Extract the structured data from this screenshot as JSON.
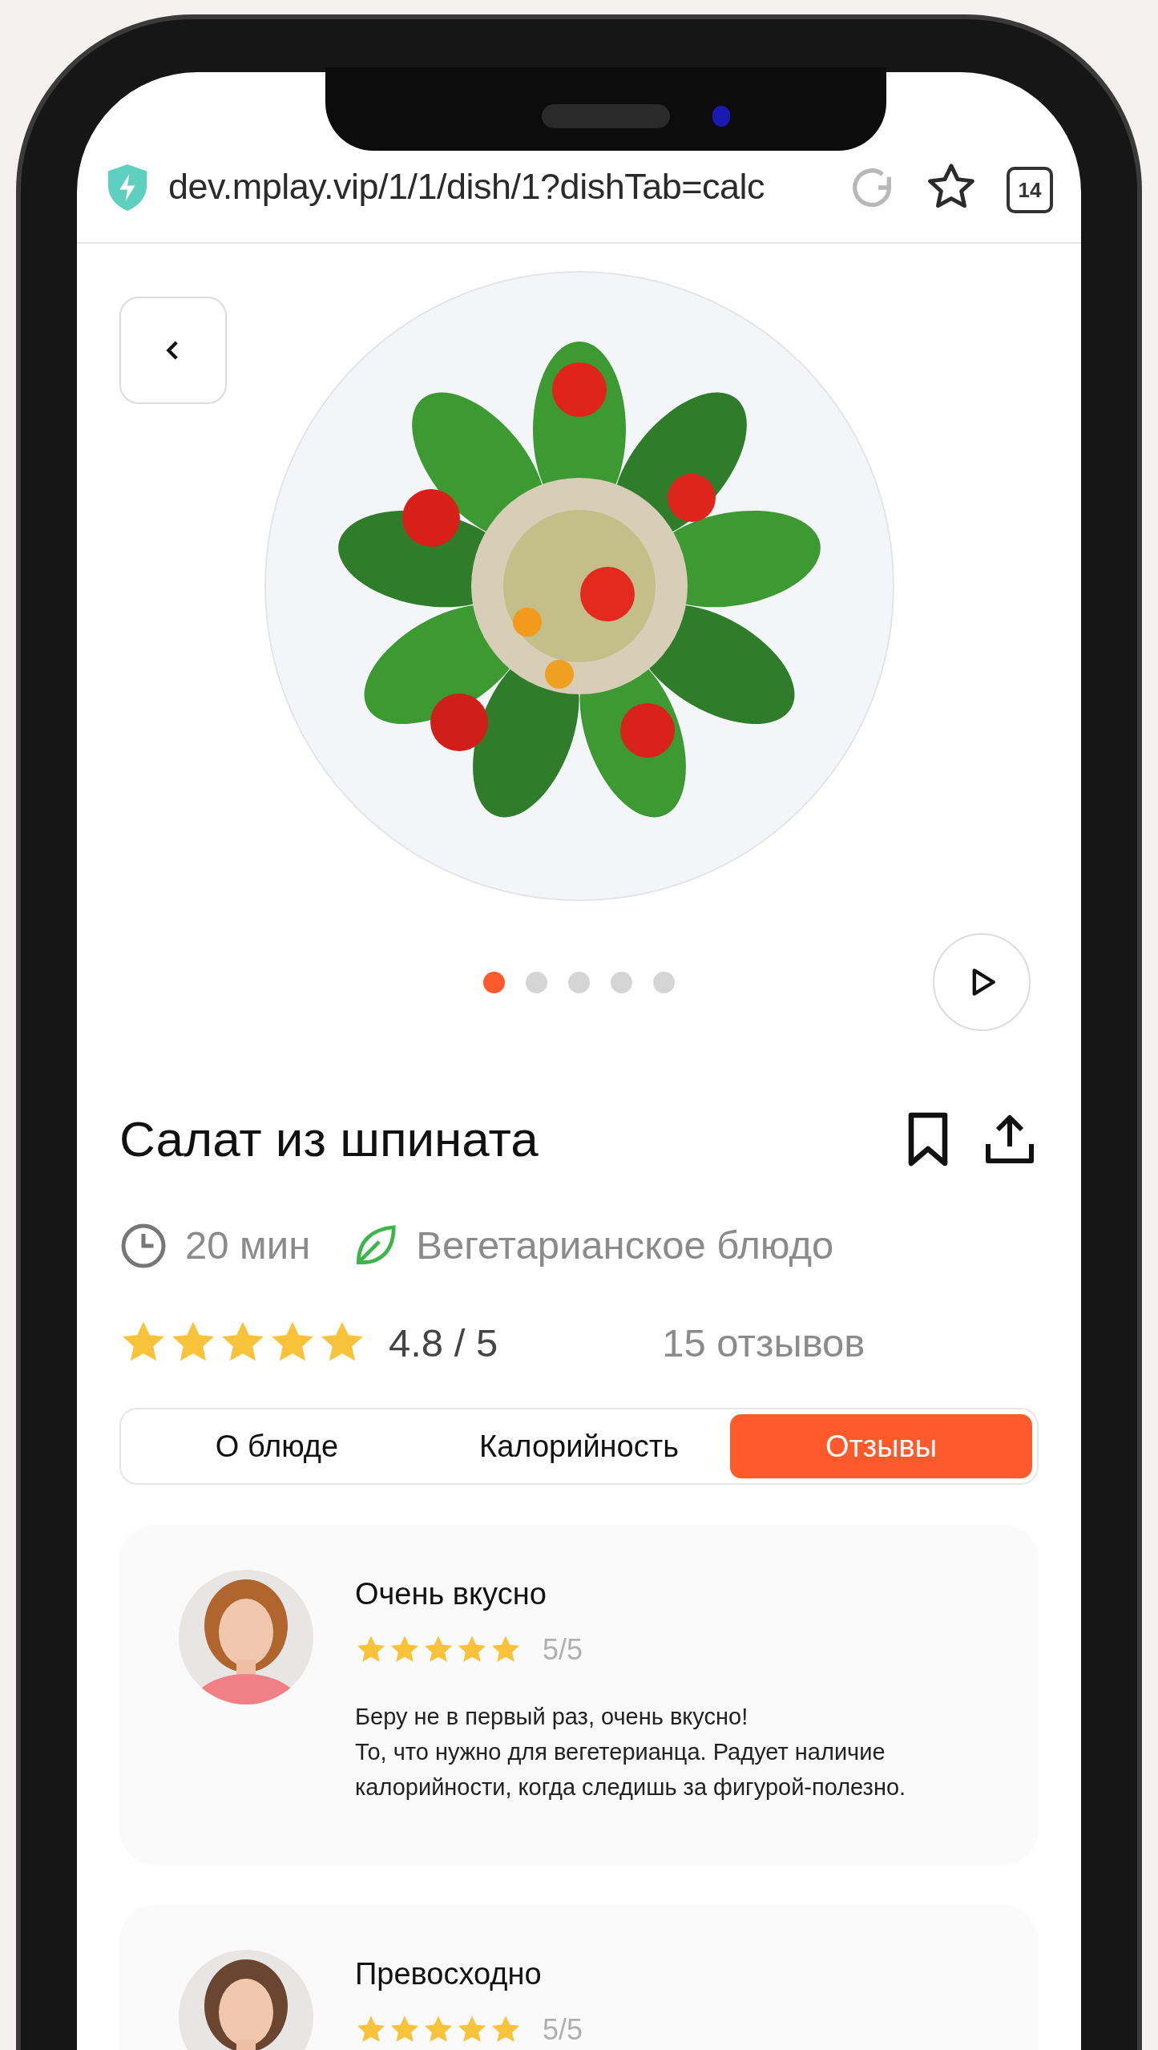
{
  "browser": {
    "url": "dev.mplay.vip/1/1/dish/1?dishTab=calc",
    "tab_count": "14"
  },
  "carousel": {
    "dots": [
      {
        "selected": true
      },
      {
        "selected": false
      },
      {
        "selected": false
      },
      {
        "selected": false
      },
      {
        "selected": false
      }
    ]
  },
  "dish": {
    "title": "Салат из шпината",
    "duration": "20 мин",
    "diet": "Вегетарианское блюдо",
    "stars": 5,
    "rating": "4.8 / 5",
    "reviews_count": "15 отзывов"
  },
  "tabs": [
    {
      "label": "О блюде",
      "selected": false
    },
    {
      "label": "Калорийность",
      "selected": false
    },
    {
      "label": "Отзывы",
      "selected": true
    }
  ],
  "reviews": [
    {
      "title": "Очень вкусно",
      "stars": 5,
      "score": "5/5",
      "text": "Беру не в первый раз, очень вкусно!\nТо, что нужно для вегетерианца. Радует наличие калорийности, когда следишь за фигурой-полезно."
    },
    {
      "title": "Превосходно",
      "stars": 5,
      "score": "5/5"
    }
  ]
}
